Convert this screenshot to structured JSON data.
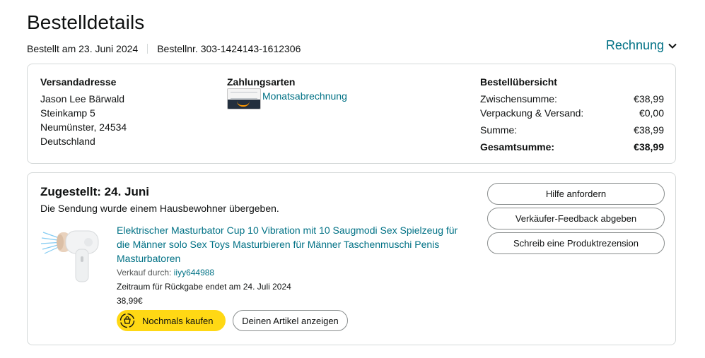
{
  "header": {
    "title": "Bestelldetails",
    "ordered_on": "Bestellt am 23. Juni 2024",
    "order_number": "Bestellnr. 303-1424143-1612306",
    "invoice_label": "Rechnung"
  },
  "summary_card": {
    "shipping": {
      "heading": "Versandadresse",
      "lines": [
        "Jason Lee Bärwald",
        "Steinkamp 5",
        "Neumünster, 24534",
        "Deutschland"
      ]
    },
    "payment": {
      "heading": "Zahlungsarten",
      "method": "Monatsabrechnung"
    },
    "overview": {
      "heading": "Bestellübersicht",
      "rows": [
        {
          "label": "Zwischensumme:",
          "value": "€38,99"
        },
        {
          "label": "Verpackung & Versand:",
          "value": "€0,00"
        },
        {
          "label": "Summe:",
          "value": "€38,99"
        },
        {
          "label": "Gesamtsumme:",
          "value": "€38,99"
        }
      ]
    }
  },
  "shipment": {
    "status": "Zugestellt: 24. Juni",
    "note": "Die Sendung wurde einem Hausbewohner übergeben.",
    "item": {
      "title": "Elektrischer Masturbator Cup 10 Vibration mit 10 Saugmodi Sex Spielzeug für die Männer solo Sex Toys Masturbieren für Männer Taschenmuschi Penis Masturbatoren",
      "seller_prefix": "Verkauf durch:",
      "seller_name": "iiyy644988",
      "return_window": "Zeitraum für Rückgabe endet am 24. Juli 2024",
      "price": "38,99€",
      "buy_again_label": "Nochmals kaufen",
      "view_item_label": "Deinen Artikel anzeigen"
    },
    "actions": {
      "help": "Hilfe anfordern",
      "seller_feedback": "Verkäufer-Feedback abgeben",
      "write_review": "Schreib eine Produktrezension"
    }
  },
  "colors": {
    "link": "#007185",
    "button_yellow": "#ffd814",
    "border": "#d5d9d9"
  }
}
